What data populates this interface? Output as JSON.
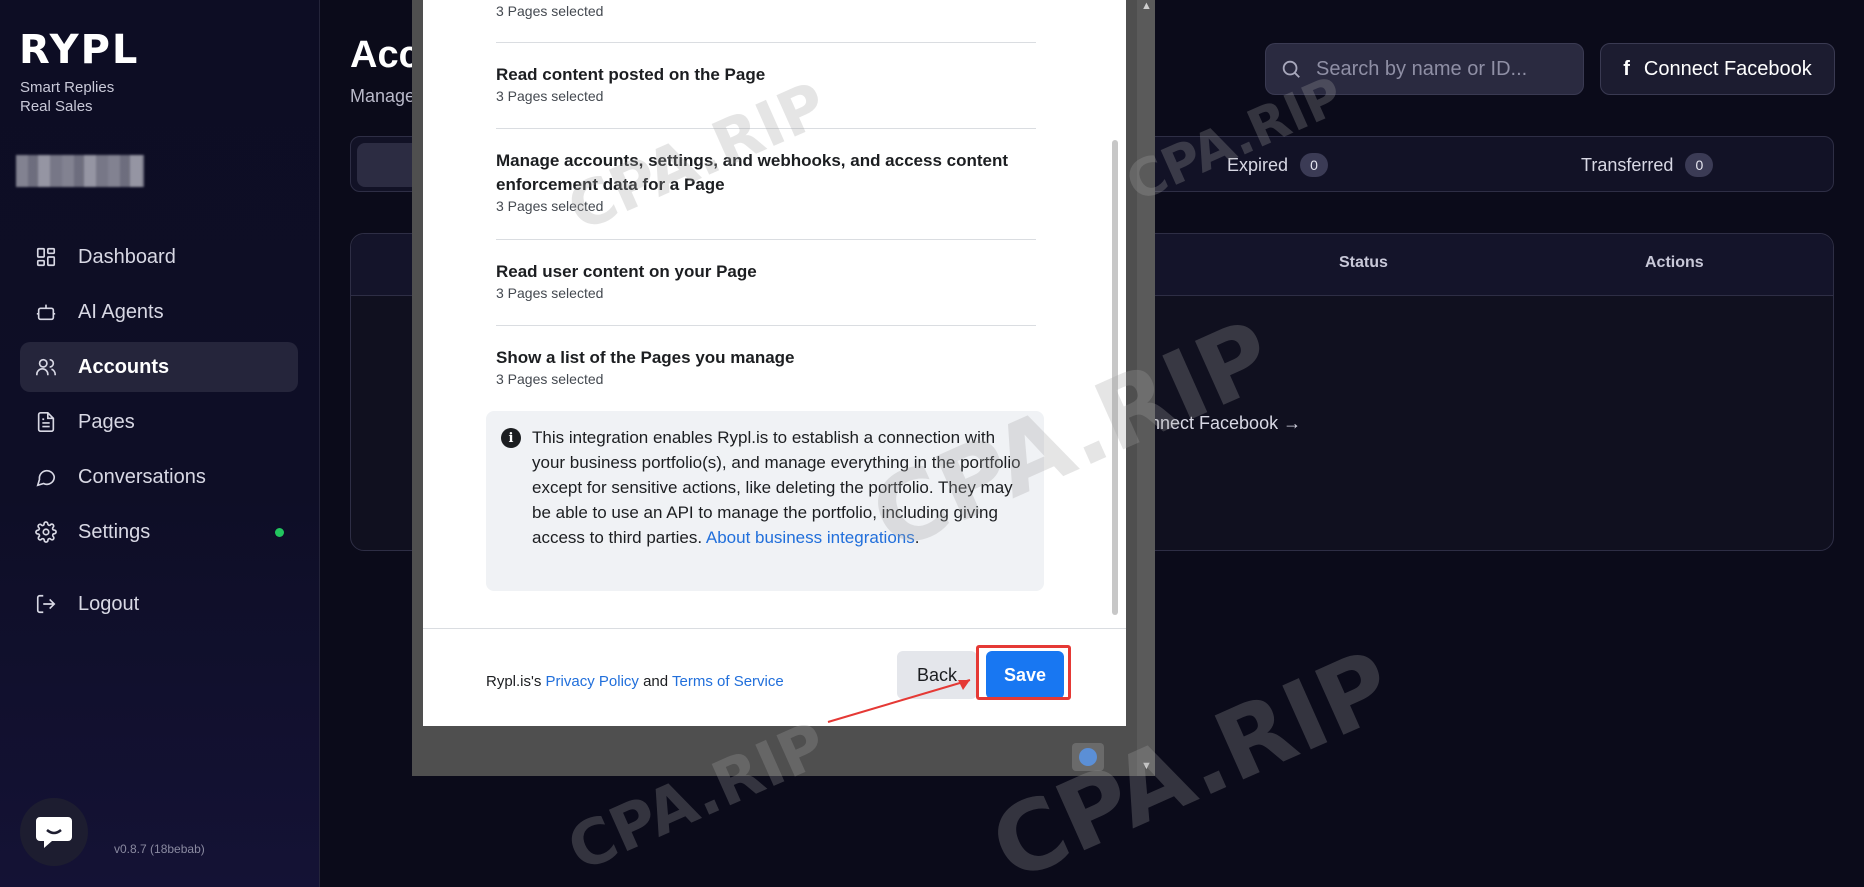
{
  "sidebar": {
    "logo": "RYPL",
    "tagline_line1": "Smart Replies",
    "tagline_line2": "Real Sales",
    "items": [
      {
        "label": "Dashboard",
        "icon": "dashboard-icon"
      },
      {
        "label": "AI Agents",
        "icon": "robot-icon"
      },
      {
        "label": "Accounts",
        "icon": "users-icon",
        "active": true
      },
      {
        "label": "Pages",
        "icon": "document-icon"
      },
      {
        "label": "Conversations",
        "icon": "chat-icon"
      },
      {
        "label": "Settings",
        "icon": "gear-icon",
        "status": "online"
      }
    ],
    "logout_label": "Logout",
    "version": "v0.8.7 (18bebab)"
  },
  "header": {
    "title": "Acc",
    "subtitle": "Manage",
    "search_placeholder": "Search by name or ID...",
    "connect_label": "Connect Facebook"
  },
  "tabs": [
    {
      "label": "Expired",
      "count": "0"
    },
    {
      "label": "Transferred",
      "count": "0"
    }
  ],
  "table": {
    "columns": [
      "Status",
      "Actions"
    ],
    "empty_link": "nnect Facebook →"
  },
  "dialog": {
    "permissions": [
      {
        "title": "",
        "subtitle": "3 Pages selected"
      },
      {
        "title": "Read content posted on the Page",
        "subtitle": "3 Pages selected"
      },
      {
        "title": "Manage accounts, settings, and webhooks, and access content enforcement data for a Page",
        "subtitle": "3 Pages selected"
      },
      {
        "title": "Read user content on your Page",
        "subtitle": "3 Pages selected"
      },
      {
        "title": "Show a list of the Pages you manage",
        "subtitle": "3 Pages selected"
      }
    ],
    "info_text": "This integration enables Rypl.is to establish a connection with your business portfolio(s), and manage everything in the portfolio except for sensitive actions, like deleting the portfolio. They may be able to use an API to manage the portfolio, including giving access to third parties.",
    "info_link": "About business integrations",
    "info_end": ".",
    "legal_prefix": "Rypl.is's",
    "privacy_label": "Privacy Policy",
    "legal_and": "and",
    "terms_label": "Terms of Service",
    "back_label": "Back",
    "save_label": "Save"
  },
  "watermark": "CPA.RIP",
  "colors": {
    "accent": "#1877f2",
    "highlight": "#e53935",
    "online": "#22c55e"
  }
}
